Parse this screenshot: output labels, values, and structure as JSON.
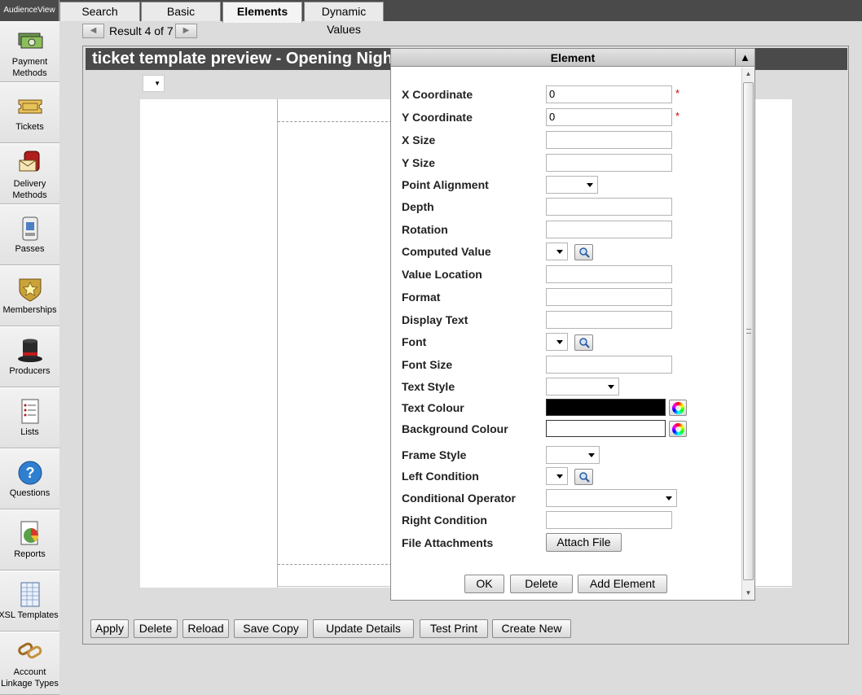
{
  "app": {
    "brand": "AudienceView"
  },
  "sidebar": {
    "items": [
      {
        "label": "Payment Methods",
        "icon": "money-icon"
      },
      {
        "label": "Tickets",
        "icon": "ticket-icon"
      },
      {
        "label": "Delivery Methods",
        "icon": "mailbox-icon"
      },
      {
        "label": "Passes",
        "icon": "season-pass-icon"
      },
      {
        "label": "Memberships",
        "icon": "membership-badge-icon"
      },
      {
        "label": "Producers",
        "icon": "top-hat-icon"
      },
      {
        "label": "Lists",
        "icon": "list-icon"
      },
      {
        "label": "Questions",
        "icon": "question-icon"
      },
      {
        "label": "Reports",
        "icon": "pie-chart-icon"
      },
      {
        "label": "XSL Templates",
        "icon": "spreadsheet-icon"
      },
      {
        "label": "Account Linkage Types",
        "icon": "linked-chain-icon"
      }
    ]
  },
  "tabs": [
    {
      "label": "Search",
      "active": false
    },
    {
      "label": "Basic",
      "active": false
    },
    {
      "label": "Elements",
      "active": true
    },
    {
      "label": "Dynamic Values",
      "active": false
    }
  ],
  "pager": {
    "text": "Result 4 of 7",
    "prev": "◀",
    "next": "▶"
  },
  "preview": {
    "title": "ticket template preview - Opening Night"
  },
  "bottom_buttons": [
    "Apply",
    "Delete",
    "Reload",
    "Save Copy",
    "Update Details",
    "Test Print",
    "Create New"
  ],
  "dialog": {
    "title": "Element",
    "collapse": "▲",
    "fields": {
      "x_coordinate": {
        "label": "X Coordinate",
        "value": "0",
        "required": "*"
      },
      "y_coordinate": {
        "label": "Y Coordinate",
        "value": "0",
        "required": "*"
      },
      "x_size": {
        "label": "X Size",
        "value": ""
      },
      "y_size": {
        "label": "Y Size",
        "value": ""
      },
      "point_alignment": {
        "label": "Point Alignment",
        "value": ""
      },
      "depth": {
        "label": "Depth",
        "value": ""
      },
      "rotation": {
        "label": "Rotation",
        "value": ""
      },
      "computed_value": {
        "label": "Computed Value",
        "value": ""
      },
      "value_location": {
        "label": "Value Location",
        "value": ""
      },
      "format": {
        "label": "Format",
        "value": ""
      },
      "display_text": {
        "label": "Display Text",
        "value": ""
      },
      "font": {
        "label": "Font",
        "value": ""
      },
      "font_size": {
        "label": "Font Size",
        "value": ""
      },
      "text_style": {
        "label": "Text Style",
        "value": ""
      },
      "text_colour": {
        "label": "Text Colour",
        "color": "#000000"
      },
      "background_colour": {
        "label": "Background Colour",
        "color": "#ffffff"
      },
      "frame_style": {
        "label": "Frame Style",
        "value": ""
      },
      "left_condition": {
        "label": "Left Condition",
        "value": ""
      },
      "conditional_operator": {
        "label": "Conditional Operator",
        "value": ""
      },
      "right_condition": {
        "label": "Right Condition",
        "value": ""
      },
      "file_attachments": {
        "label": "File Attachments",
        "button": "Attach File"
      }
    },
    "buttons": {
      "ok": "OK",
      "delete": "Delete",
      "add_element": "Add Element"
    }
  }
}
